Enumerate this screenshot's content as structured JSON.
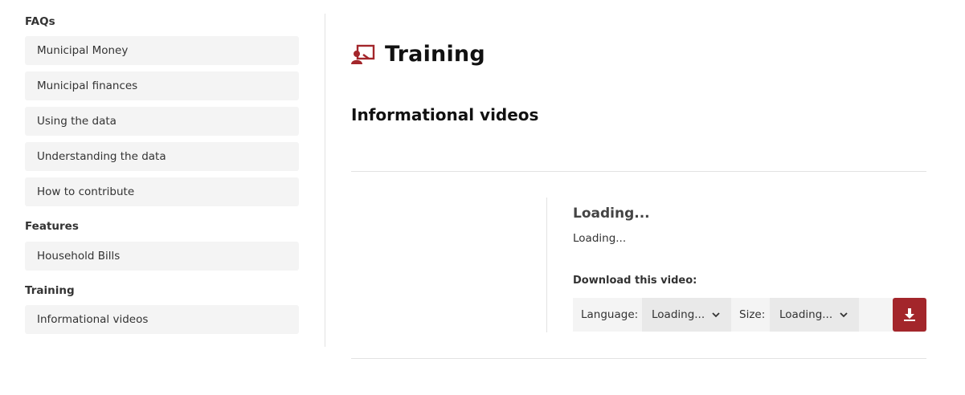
{
  "sidebar": {
    "sections": [
      {
        "heading": "FAQs",
        "items": [
          "Municipal Money",
          "Municipal finances",
          "Using the data",
          "Understanding the data",
          "How to contribute"
        ]
      },
      {
        "heading": "Features",
        "items": [
          "Household Bills"
        ]
      },
      {
        "heading": "Training",
        "items": [
          "Informational videos"
        ]
      }
    ]
  },
  "main": {
    "title": "Training",
    "title_icon": "presentation-icon",
    "subtitle": "Informational videos",
    "video": {
      "title": "Loading...",
      "description": "Loading...",
      "download_label": "Download this video:",
      "language_label": "Language:",
      "language_value": "Loading...",
      "size_label": "Size:",
      "size_value": "Loading...",
      "download_icon": "download-icon"
    }
  },
  "colors": {
    "accent": "#a3262b",
    "nav_bg": "#f4f4f4"
  }
}
